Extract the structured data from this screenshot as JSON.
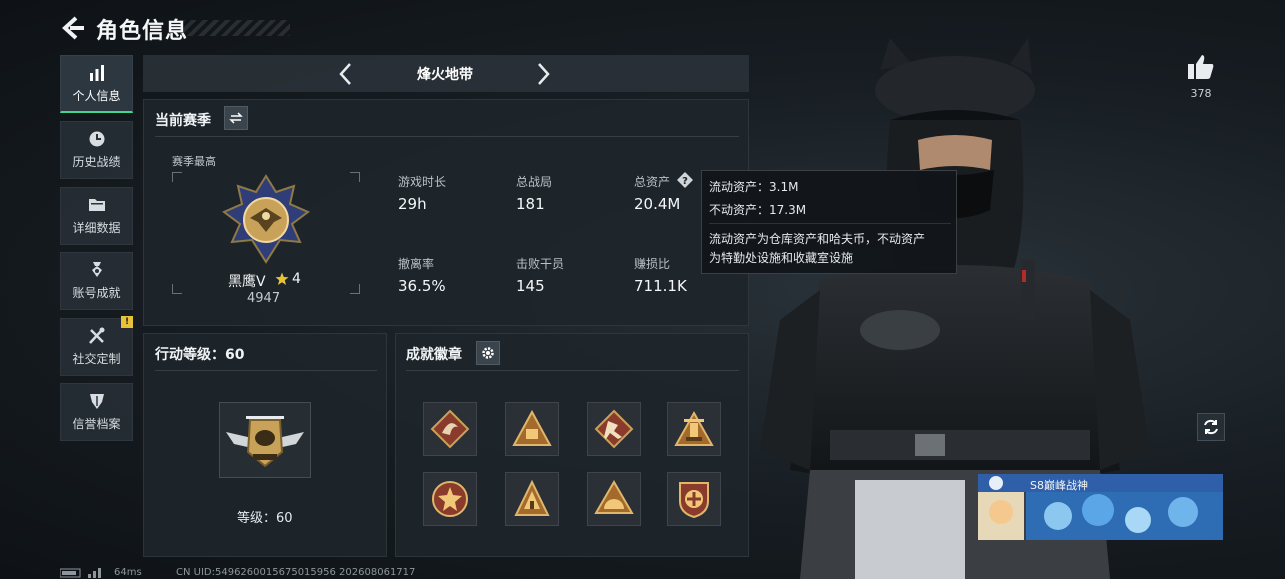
{
  "header": {
    "title": "角色信息"
  },
  "sidebar": {
    "items": [
      {
        "label": "个人信息",
        "icon": "bar-chart-icon",
        "active": true
      },
      {
        "label": "历史战绩",
        "icon": "clock-icon"
      },
      {
        "label": "详细数据",
        "icon": "folder-icon"
      },
      {
        "label": "账号成就",
        "icon": "medal-icon"
      },
      {
        "label": "社交定制",
        "icon": "tools-icon",
        "badge": "!"
      },
      {
        "label": "信誉档案",
        "icon": "shield-icon"
      }
    ]
  },
  "mode": {
    "name": "烽火地带"
  },
  "season": {
    "title": "当前赛季",
    "best_label": "赛季最高",
    "rank_name": "黑鹰V",
    "rank_stars": "4",
    "rank_score": "4947"
  },
  "stats": [
    {
      "label": "游戏时长",
      "value": "29h"
    },
    {
      "label": "总战局",
      "value": "181"
    },
    {
      "label": "总资产",
      "value": "20.4M"
    },
    {
      "label": "撤离率",
      "value": "36.5%"
    },
    {
      "label": "击败干员",
      "value": "145"
    },
    {
      "label": "赚损比",
      "value": "711.1K"
    }
  ],
  "tooltip": {
    "line1": "流动资产：3.1M",
    "line2": "不动资产：17.3M",
    "line3": "流动资产为仓库资产和哈夫币，不动资产",
    "line4": "为特勤处设施和收藏室设施"
  },
  "action_level": {
    "title": "行动等级：60",
    "level_text": "等级：60"
  },
  "achievements": {
    "title": "成就徽章",
    "badges": [
      "dragon-badge-icon",
      "pyramid-badge-icon",
      "runner-badge-icon",
      "tower-badge-icon",
      "star-shield-badge-icon",
      "tent-badge-icon",
      "sun-badge-icon",
      "cross-shield-badge-icon"
    ]
  },
  "right": {
    "like_count": "378",
    "title_tag": "S8巅峰战神"
  },
  "footer": {
    "ping": "64ms",
    "uid": "CN UID:5496260015675015956 202608061717"
  },
  "colors": {
    "accent": "#3fd68f",
    "gold": "#c9a25a",
    "badge": "#e7c23a"
  }
}
